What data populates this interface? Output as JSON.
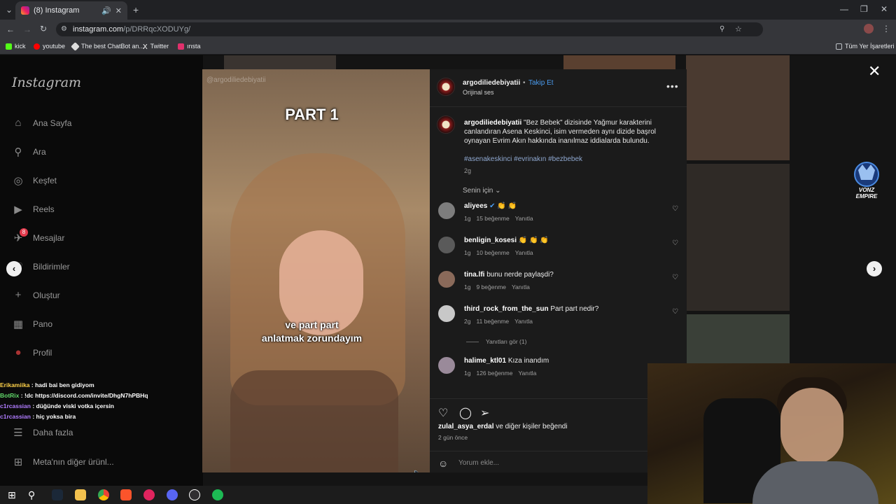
{
  "browser": {
    "tab_title": "(8) Instagram",
    "url_host": "instagram.com",
    "url_path": "/p/DRRqcXODUYg/",
    "bookmarks": [
      {
        "label": "kick",
        "color": "#53fc18"
      },
      {
        "label": "youtube",
        "color": "#ff0000"
      },
      {
        "label": "The best ChatBot an...",
        "color": "#dddddd"
      },
      {
        "label": "Twitter",
        "color": "#ffffff"
      },
      {
        "label": "ınsta",
        "color": "#e1306c"
      }
    ],
    "bookmarks_folder": "Tüm Yer İşaretleri"
  },
  "sidebar": {
    "logo": "Instagram",
    "items": [
      {
        "label": "Ana Sayfa",
        "icon": "home-icon",
        "glyph": "⌂"
      },
      {
        "label": "Ara",
        "icon": "search-icon",
        "glyph": "⚲"
      },
      {
        "label": "Keşfet",
        "icon": "compass-icon",
        "glyph": "◎"
      },
      {
        "label": "Reels",
        "icon": "reels-icon",
        "glyph": "▶"
      },
      {
        "label": "Mesajlar",
        "icon": "messages-icon",
        "glyph": "✈"
      },
      {
        "label": "Bildirimler",
        "icon": "heart-icon",
        "glyph": "♡"
      },
      {
        "label": "Oluştur",
        "icon": "plus-icon",
        "glyph": "+"
      },
      {
        "label": "Pano",
        "icon": "dashboard-icon",
        "glyph": "▦"
      },
      {
        "label": "Profil",
        "icon": "profile-icon",
        "glyph": "●"
      },
      {
        "label": "Daha fazla",
        "icon": "menu-icon",
        "glyph": "☰"
      },
      {
        "label": "Meta'nın diğer ürünl...",
        "icon": "meta-icon",
        "glyph": "⊞"
      }
    ],
    "messages_badge": "8"
  },
  "video": {
    "watermark": "@argodiliedebiyatii",
    "title": "PART 1",
    "caption_line1": "ve part part",
    "caption_line2": "anlatmak zorundayım"
  },
  "post": {
    "author": "argodiliedebiyatii",
    "follow_label": "Takip Et",
    "audio": "Orijinal ses",
    "caption": "\"Bez Bebek\" dizisinde Yağmur karakterini canlandıran Asena Keskinci, isim vermeden aynı dizide başrol oynayan Evrim Akın hakkında inanılmaz iddialarda bulundu.",
    "hashtags": "#asenakeskinci #evrinakın #bezbebek",
    "caption_age": "2g",
    "sort_label": "Senin için",
    "comments": [
      {
        "user": "aliyees",
        "text": "👏 👏",
        "age": "1g",
        "likes": "15 beğenme",
        "reply": "Yanıtla",
        "avatar_color": "#7d7d7d"
      },
      {
        "user": "benligin_kosesi",
        "text": "👏 👏 👏",
        "age": "1g",
        "likes": "10 beğenme",
        "reply": "Yanıtla",
        "avatar_color": "#5a5a5a"
      },
      {
        "user": "tina.lfi",
        "text": "bunu nerde paylaşdi?",
        "age": "1g",
        "likes": "9 beğenme",
        "reply": "Yanıtla",
        "avatar_color": "#8a6a5a"
      },
      {
        "user": "third_rock_from_the_sun",
        "text": "Part part nedir?",
        "age": "2g",
        "likes": "11 beğenme",
        "reply": "Yanıtla",
        "avatar_color": "#c8c8c8"
      },
      {
        "user": "halime_ktl01",
        "text": "Kıza inandım",
        "age": "1g",
        "likes": "126 beğenme",
        "reply": "Yanıtla",
        "avatar_color": "#9a8a9a"
      }
    ],
    "view_replies": "Yanıtları gör (1)",
    "liked_by_user": "zulal_asya_erdal",
    "liked_by_rest": "ve diğer kişiler beğendi",
    "post_date": "2 gün önce",
    "comment_placeholder": "Yorum ekle..."
  },
  "chat": [
    {
      "user": "Erikamiika",
      "msg": "hadi bai ben gidiyom",
      "color": "u1"
    },
    {
      "user": "BotRix",
      "msg": "!dc https://discord.com/invite/DhgN7hPBHq",
      "color": "u2"
    },
    {
      "user": "c1rcassian",
      "msg": "düğünde viski votka içersin",
      "color": "u3"
    },
    {
      "user": "c1rcassian",
      "msg": "hiç yoksa bira",
      "color": "u3"
    }
  ],
  "stream_logo": "VONZ EMPIRE"
}
